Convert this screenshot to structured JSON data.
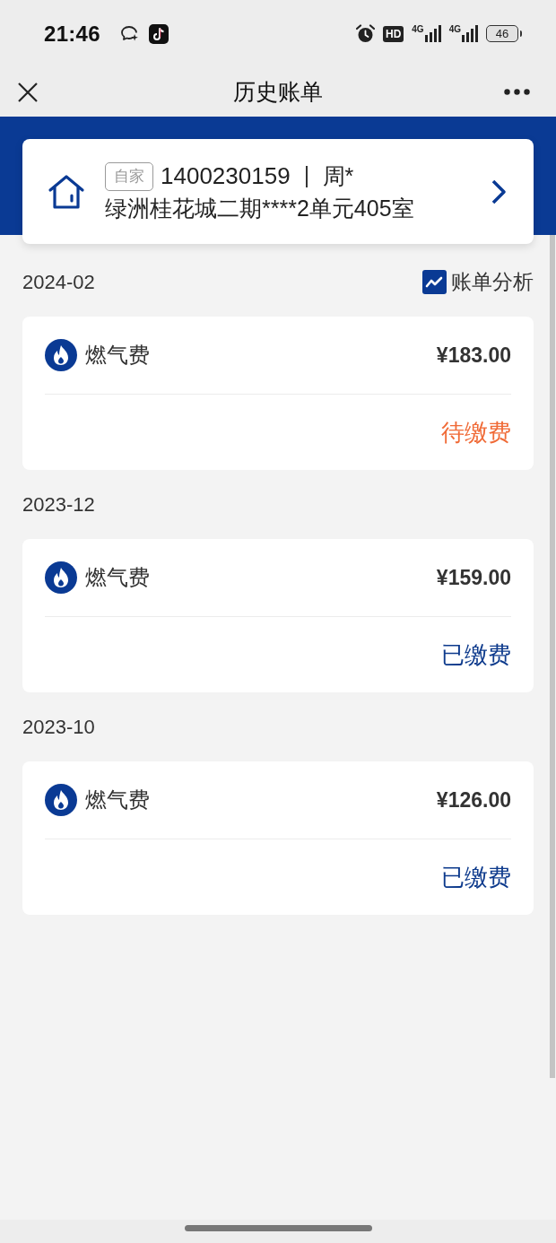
{
  "status_bar": {
    "time": "21:46",
    "hd_label": "HD",
    "networks": [
      {
        "label": "4G"
      },
      {
        "label": "4G"
      }
    ],
    "battery": "46"
  },
  "nav_bar": {
    "title": "历史账单"
  },
  "account": {
    "tag": "自家",
    "number": "1400230159",
    "holder": "周*",
    "address": "绿洲桂花城二期****2单元405室"
  },
  "months": [
    {
      "month": "2024-02",
      "action": "账单分析",
      "bills": [
        {
          "name": "燃气费",
          "amount": "¥183.00",
          "status": "待缴费",
          "paid": false
        }
      ]
    },
    {
      "month": "2023-12",
      "bills": [
        {
          "name": "燃气费",
          "amount": "¥159.00",
          "status": "已缴费",
          "paid": true
        }
      ]
    },
    {
      "month": "2023-10",
      "bills": [
        {
          "name": "燃气费",
          "amount": "¥126.00",
          "status": "已缴费",
          "paid": true
        }
      ]
    }
  ]
}
